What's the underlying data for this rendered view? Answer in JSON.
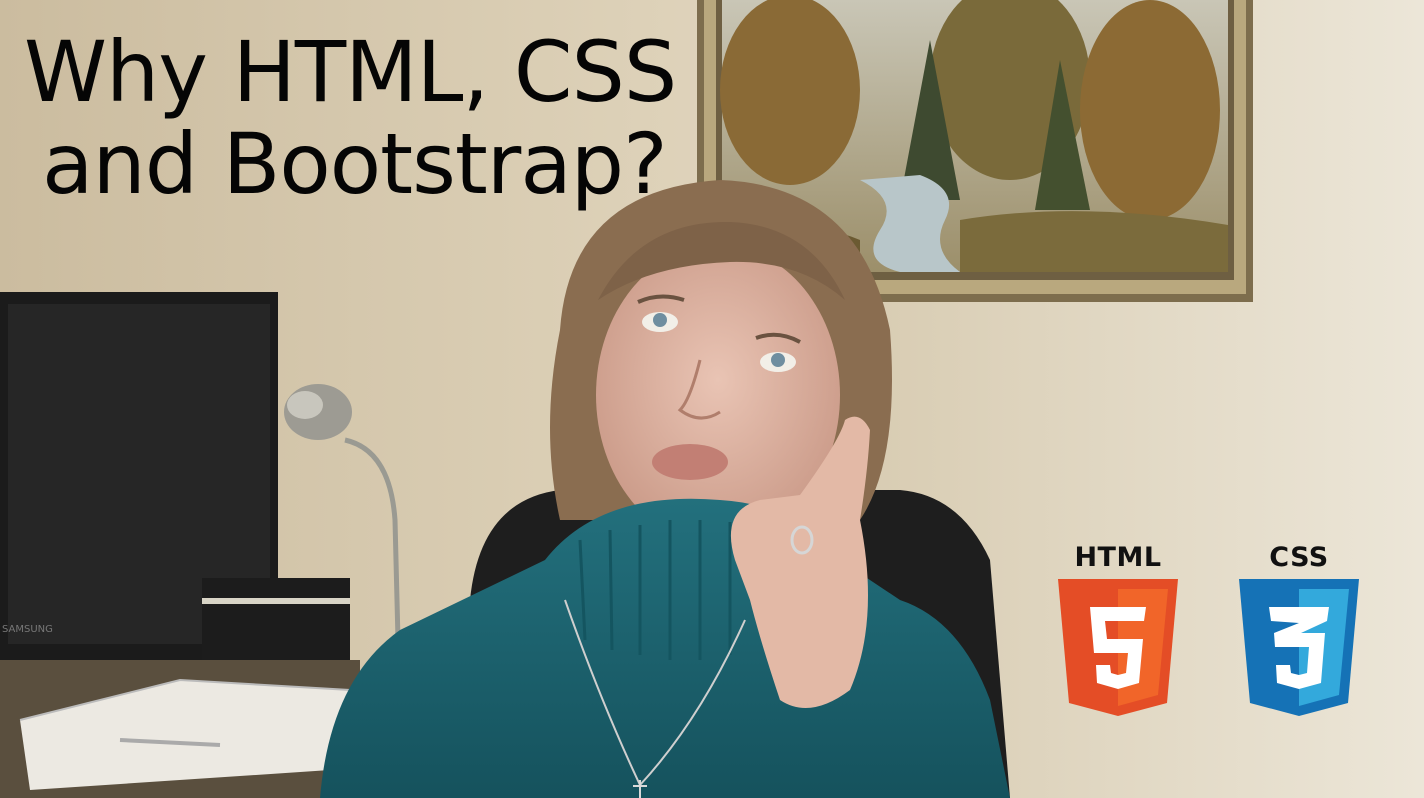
{
  "title": {
    "line1": "Why HTML, CSS",
    "line2": "and Bootstrap?"
  },
  "logos": {
    "html": {
      "label": "HTML",
      "digit": "5",
      "color": "#e44d26",
      "shade": "#f16529"
    },
    "css": {
      "label": "CSS",
      "digit": "3",
      "color": "#1572b6",
      "shade": "#33a9dc"
    }
  },
  "monitor": {
    "brand": "SAMSUNG"
  },
  "colors": {
    "sweater": "#1d6673",
    "wall": "#e2d8c4",
    "frame": "#8a7a5a"
  }
}
